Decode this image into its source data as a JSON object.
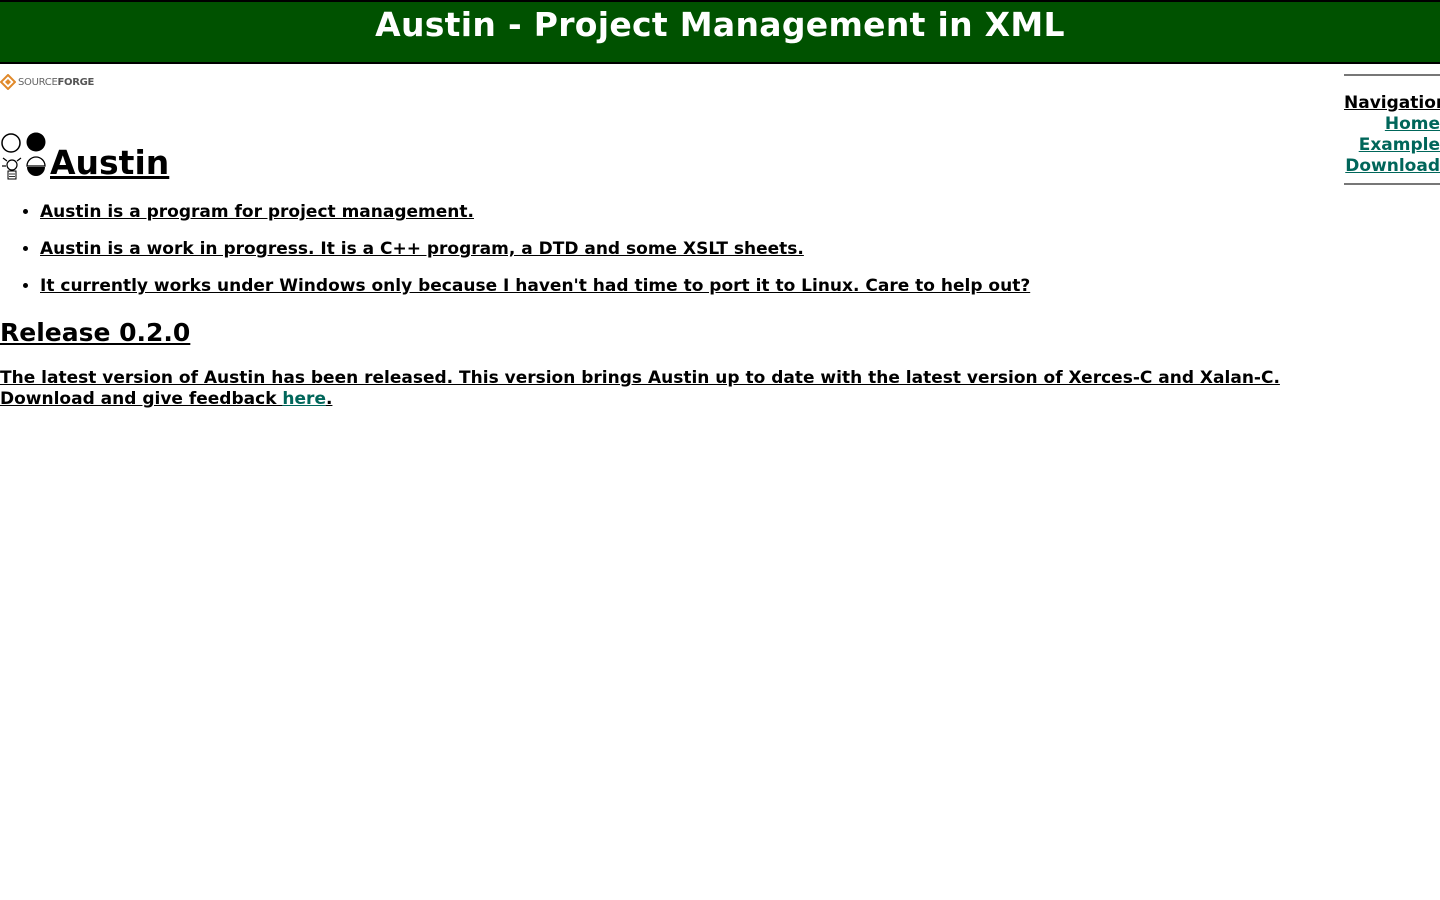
{
  "header": {
    "title": "Austin - Project Management in XML"
  },
  "sourceforge": {
    "source": "SOURCE",
    "forge": "FORGE"
  },
  "navigation": {
    "title": "Navigation",
    "links": [
      "Home",
      "Example",
      "Download"
    ]
  },
  "main": {
    "title": "Austin",
    "bullets": [
      "Austin is a program for project management.",
      "Austin is a work in progress. It is a C++ program, a DTD and some XSLT sheets.",
      "It currently works under Windows only because I haven't had time to port it to Linux. Care to help out?"
    ]
  },
  "release": {
    "heading": "Release 0.2.0",
    "text_before": "The latest version of Austin has been released. This version brings Austin up to date with the latest version of Xerces-C and Xalan-C. Download and give feedback ",
    "link_label": "here",
    "text_after": "."
  },
  "colors": {
    "banner": "#005200",
    "link": "#00665a"
  }
}
